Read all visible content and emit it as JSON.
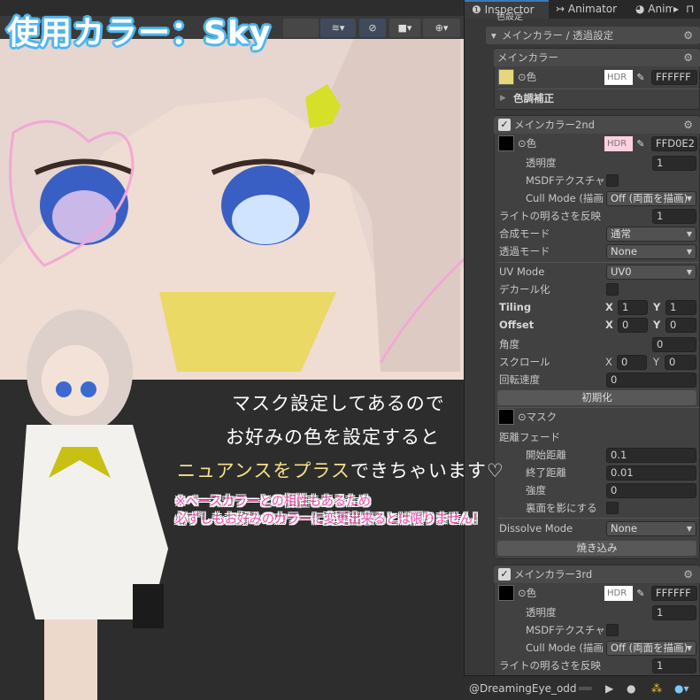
{
  "overlay": {
    "title": "使用カラー：Sky",
    "caption_line1": "マスク設定してあるので",
    "caption_line2_a": "お好みの色",
    "caption_line2_b": "を設定すると",
    "caption_line3_a": "ニュアンスをプラス",
    "caption_line3_b": "できちゃいます♡",
    "note_line1": "※ベースカラーとの相性もあるため",
    "note_line2": "必ずしもお好みのカラーに変更出来るとは限りません！"
  },
  "tabs": [
    {
      "label": "Inspector",
      "icon": "info-icon"
    },
    {
      "label": "Animator",
      "icon": "animator-icon"
    },
    {
      "label": "Anim",
      "icon": "clock-icon"
    }
  ],
  "inspector": {
    "section_hidden": "色設定",
    "section": "メインカラー / 透過設定",
    "main": {
      "title": "メインカラー",
      "color_label": "⊙色",
      "hdr": "HDR",
      "hex": "FFFFFF",
      "tone": "色調補正"
    },
    "second": {
      "title": "メインカラー2nd",
      "color_label": "⊙色",
      "hdr": "HDR",
      "hex": "FFD0E2",
      "opacity_label": "透明度",
      "opacity": "1",
      "msdf_label": "MSDFテクスチャ",
      "cull_label": "Cull Mode (描画",
      "cull": "Off (両面を描画)",
      "light_label": "ライトの明るさを反映",
      "light": "1",
      "blend_label": "合成モード",
      "blend": "通常",
      "alpha_label": "透過モード",
      "alpha": "None",
      "uv_label": "UV Mode",
      "uv": "UV0",
      "decal_label": "デカール化",
      "tiling_label": "Tiling",
      "offset_label": "Offset",
      "tiling_x": "1",
      "tiling_y": "1",
      "offset_x": "0",
      "offset_y": "0",
      "x": "X",
      "y": "Y",
      "angle_label": "角度",
      "angle": "0",
      "scroll_label": "スクロール",
      "scroll_x": "0",
      "scroll_y": "0",
      "rot_label": "回転速度",
      "rot": "0",
      "reset": "初期化",
      "mask_label": "⊙マスク",
      "fade_label": "距離フェード",
      "fade_start_label": "開始距離",
      "fade_start": "0.1",
      "fade_end_label": "終了距離",
      "fade_end": "0.01",
      "strength_label": "強度",
      "strength": "0",
      "backface_label": "裏面を影にする",
      "dissolve_label": "Dissolve Mode",
      "dissolve": "None",
      "bake": "焼き込み"
    },
    "third": {
      "title": "メインカラー3rd",
      "color_label": "⊙色",
      "hdr": "HDR",
      "hex": "FFFFFF",
      "opacity_label": "透明度",
      "opacity": "1",
      "msdf_label": "MSDFテクスチャ",
      "cull_label": "Cull Mode (描画",
      "cull": "Off (両面を描画)",
      "light_label": "ライトの明るさを反映",
      "light": "1"
    }
  },
  "bottom": {
    "user": "@DreamingEye_odd"
  },
  "colors": {
    "accent": "#4fb6ec",
    "pink": "#ee4fae",
    "yellow": "#f5e08a",
    "second_color": "#FFD0E2"
  }
}
